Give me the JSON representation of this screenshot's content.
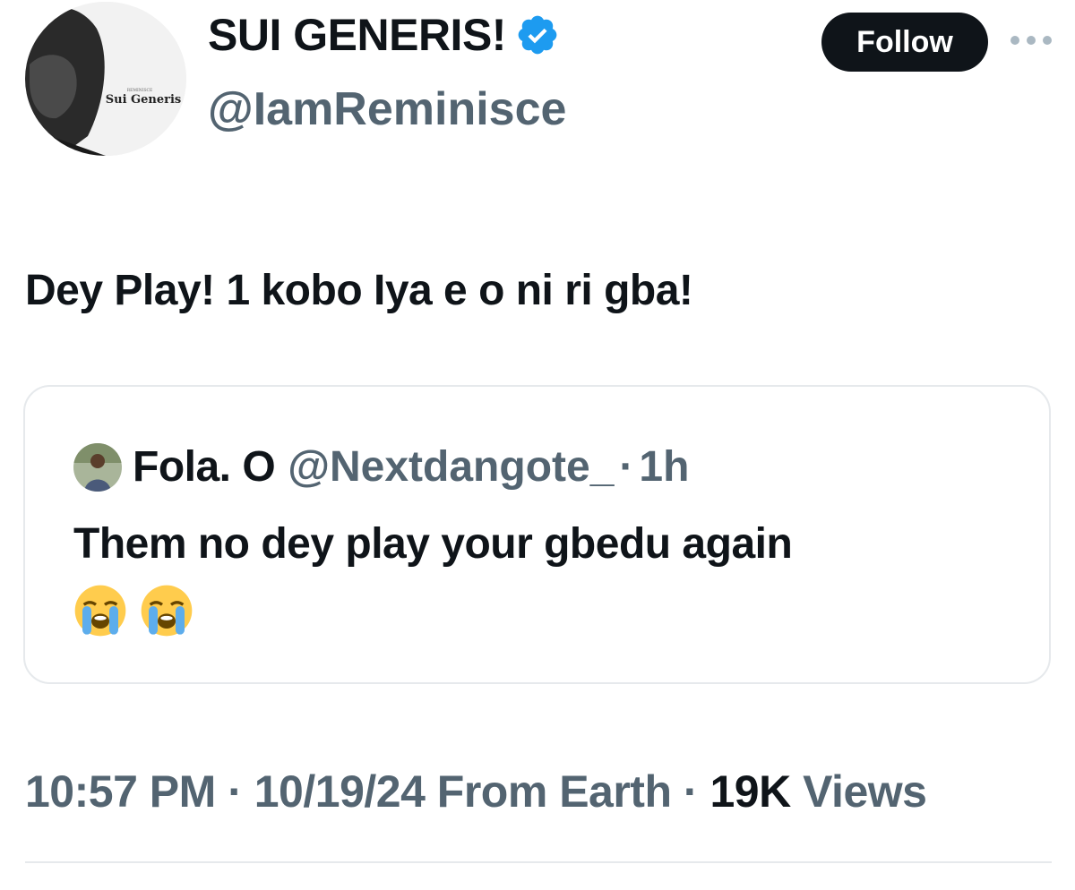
{
  "author": {
    "display_name": "SUI GENERIS!",
    "handle": "@IamReminisce",
    "avatar_text_top": "REMINISCE",
    "avatar_text": "Sui Generis",
    "verified": true
  },
  "follow_label": "Follow",
  "tweet_text": "Dey Play! 1 kobo Iya e o ni ri gba!",
  "quoted": {
    "display_name": "Fola. O",
    "handle": "@Nextdangote_",
    "separator": "·",
    "time": "1h",
    "text": "Them no dey play your gbedu again",
    "emojis": [
      "loudly-crying-face-icon",
      "loudly-crying-face-icon"
    ]
  },
  "meta": {
    "time": "10:57 PM",
    "date": "10/19/24",
    "source": "From Earth",
    "separator": "·",
    "views_count": "19K",
    "views_label": "Views"
  },
  "colors": {
    "verified": "#1d9bf0",
    "secondary_text": "#536471",
    "primary_text": "#0f1419",
    "border": "#e6e9ec"
  }
}
